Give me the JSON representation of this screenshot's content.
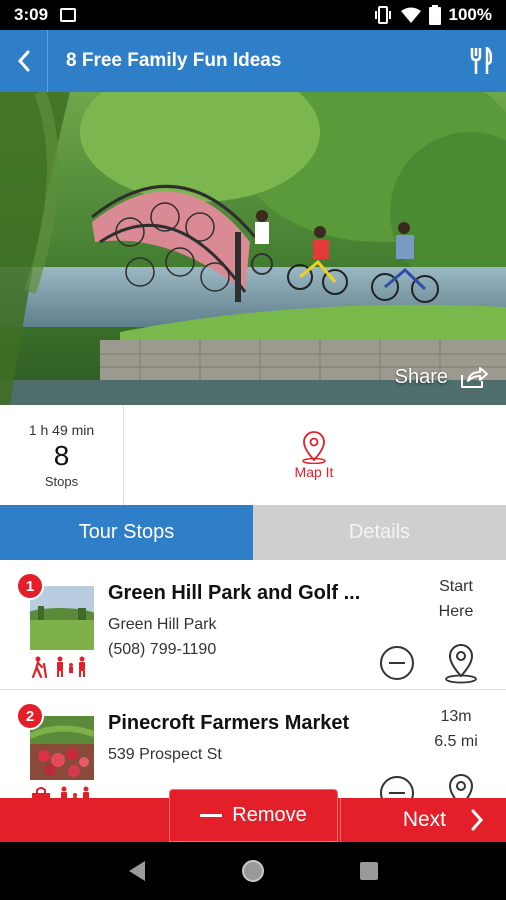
{
  "status_bar": {
    "time": "3:09",
    "battery": "100%",
    "icons": [
      "image-icon",
      "vibrate-icon",
      "wifi-icon",
      "battery-icon"
    ]
  },
  "app_bar": {
    "title": "8 Free Family Fun Ideas",
    "back_icon": "chevron-left-icon",
    "action_icon": "fork-knife-icon",
    "color": "#2f7fc8"
  },
  "hero": {
    "share_label": "Share"
  },
  "summary": {
    "duration": "1 h 49 min",
    "stop_count": "8",
    "stops_label": "Stops",
    "map_it_label": "Map It"
  },
  "tabs": [
    {
      "label": "Tour Stops",
      "active": true
    },
    {
      "label": "Details",
      "active": false
    }
  ],
  "stops": [
    {
      "number": "1",
      "name": "Green Hill Park and Golf ...",
      "address": "Green Hill Park",
      "phone": "(508) 799-1190",
      "right_line1": "Start",
      "right_line2": "Here"
    },
    {
      "number": "2",
      "name": "Pinecroft Farmers Market",
      "address": "539 Prospect St",
      "phone": "",
      "right_line1": "13m",
      "right_line2": "6.5 mi"
    }
  ],
  "bottom": {
    "remove_label": "Remove",
    "next_label": "Next",
    "accent": "#e3202a"
  }
}
